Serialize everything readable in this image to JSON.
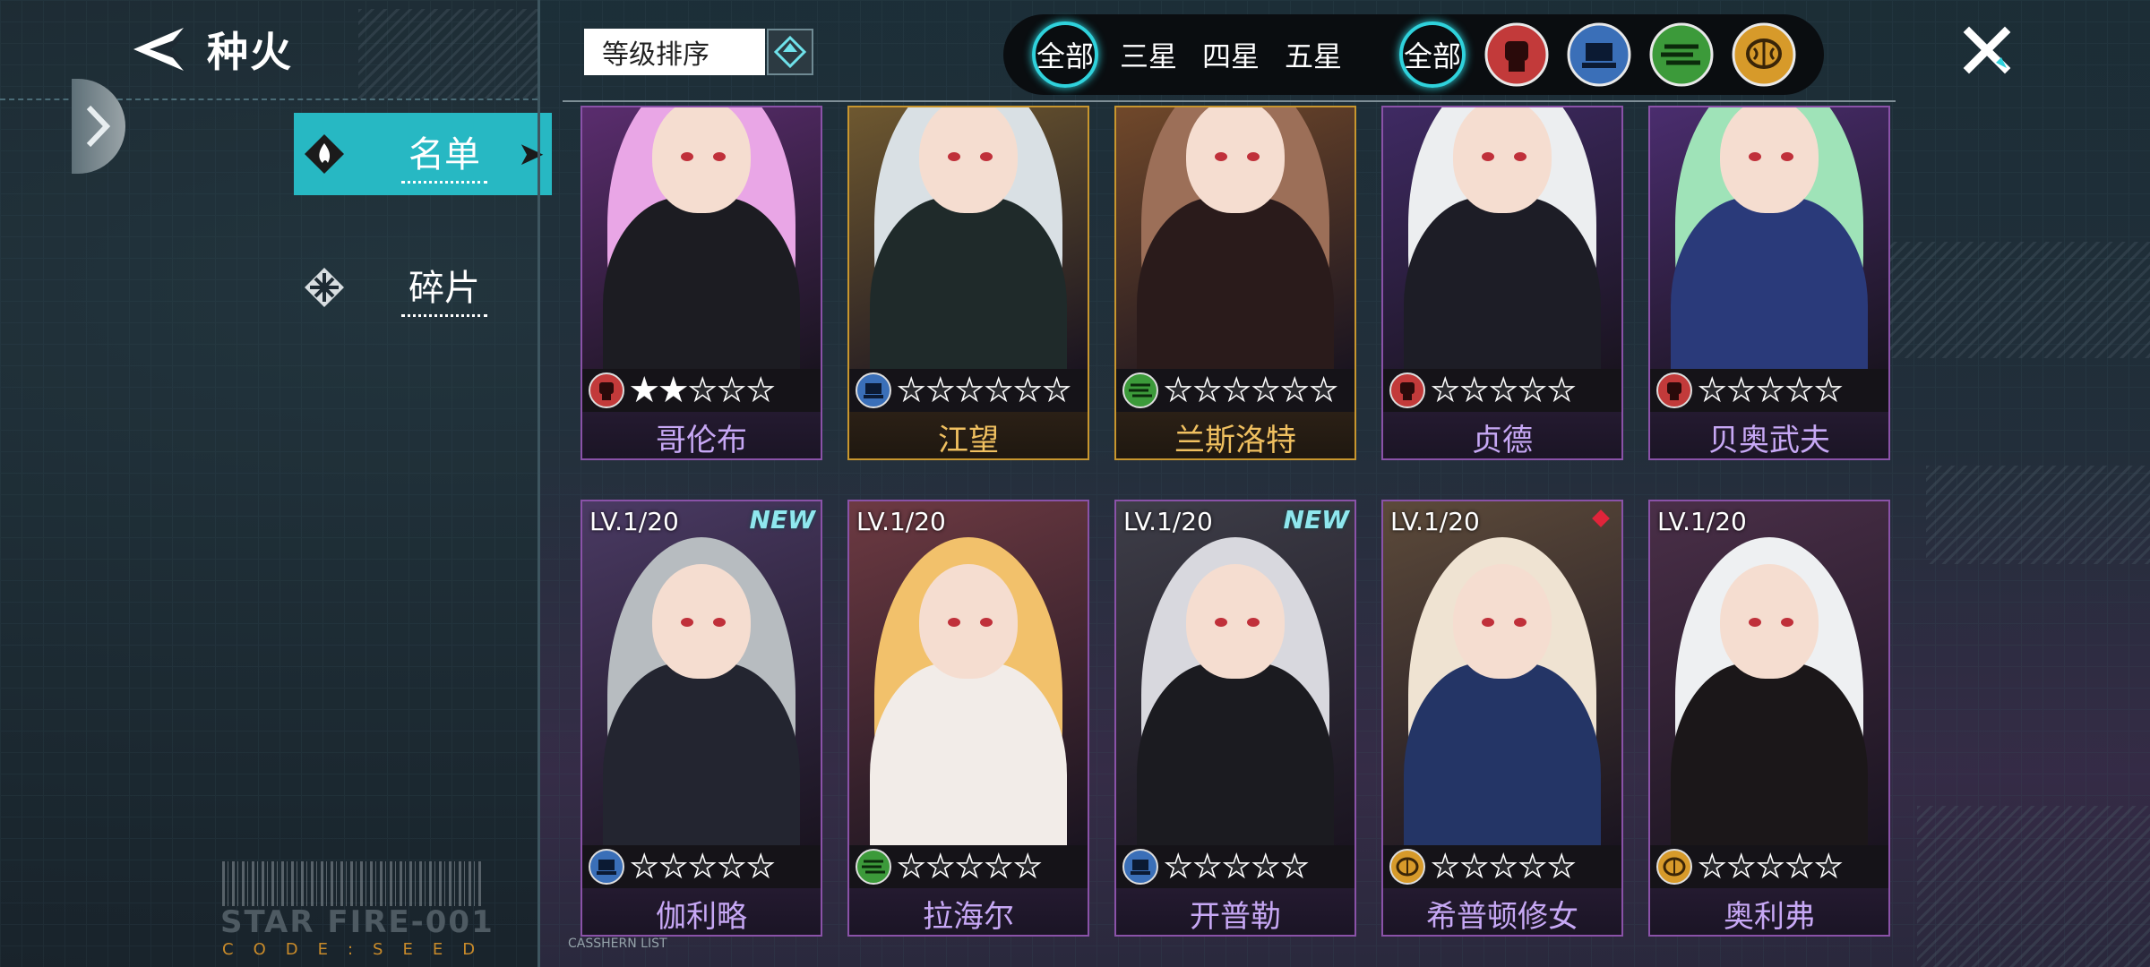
{
  "window": {
    "title": "种火"
  },
  "tabs": [
    {
      "label": "名单",
      "active": true
    },
    {
      "label": "碎片",
      "active": false
    }
  ],
  "sort": {
    "label": "等级排序"
  },
  "filters": {
    "star": [
      {
        "label": "全部",
        "selected": true
      },
      {
        "label": "三星"
      },
      {
        "label": "四星"
      },
      {
        "label": "五星"
      }
    ],
    "type": [
      {
        "label": "全部",
        "selected": true
      },
      {
        "icon": "fist-icon",
        "color": "#c23a3a"
      },
      {
        "icon": "chip-icon",
        "color": "#3a6fb8"
      },
      {
        "icon": "wave-icon",
        "color": "#3c9a3a"
      },
      {
        "icon": "brain-icon",
        "color": "#d79a2a"
      }
    ]
  },
  "decor": {
    "barcode_text": "STAR FIRE-001",
    "code_text": "CODE:SEED",
    "footer_text": "CASSHERN LIST"
  },
  "cards_row1": [
    {
      "name": "哥伦布",
      "type": "fist-icon",
      "stars": 5,
      "lit": 2,
      "frame": "purple"
    },
    {
      "name": "江望",
      "type": "chip-icon",
      "stars": 6,
      "lit": 0,
      "frame": "gold"
    },
    {
      "name": "兰斯洛特",
      "type": "wave-icon",
      "stars": 6,
      "lit": 0,
      "frame": "gold"
    },
    {
      "name": "贞德",
      "type": "fist-icon",
      "stars": 5,
      "lit": 0,
      "frame": "purple"
    },
    {
      "name": "贝奥武夫",
      "type": "fist-icon",
      "stars": 5,
      "lit": 0,
      "frame": "purple"
    }
  ],
  "cards_row2": [
    {
      "level": "LV.1/20",
      "badge": "NEW",
      "name": "伽利略",
      "type": "chip-icon",
      "stars": 5,
      "lit": 0
    },
    {
      "level": "LV.1/20",
      "badge": "",
      "name": "拉海尔",
      "type": "wave-icon",
      "stars": 5,
      "lit": 0
    },
    {
      "level": "LV.1/20",
      "badge": "NEW",
      "name": "开普勒",
      "type": "chip-icon",
      "stars": 5,
      "lit": 0
    },
    {
      "level": "LV.1/20",
      "badge": "dot",
      "name": "希普顿修女",
      "type": "brain-icon",
      "stars": 5,
      "lit": 0
    },
    {
      "level": "LV.1/20",
      "badge": "",
      "name": "奥利弗",
      "type": "brain-icon",
      "stars": 5,
      "lit": 0
    }
  ]
}
